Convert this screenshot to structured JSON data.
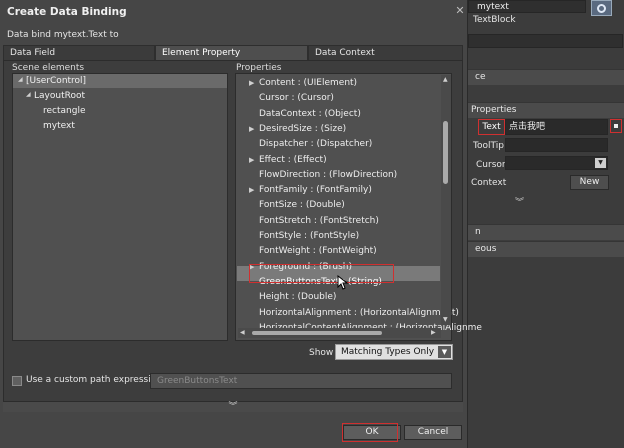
{
  "dialog": {
    "title": "Create Data Binding",
    "close_glyph": "✕",
    "bind_label": "Data bind mytext.Text to",
    "tabs": [
      {
        "label": "Data Field"
      },
      {
        "label": "Element Property"
      },
      {
        "label": "Data Context"
      }
    ],
    "scene_label": "Scene elements",
    "properties_label": "Properties",
    "tree": [
      {
        "label": "[UserControl]",
        "selected": true
      },
      {
        "label": "LayoutRoot"
      },
      {
        "label": "rectangle"
      },
      {
        "label": "mytext"
      }
    ],
    "properties": [
      {
        "label": "Content : (UIElement)",
        "expandable": true
      },
      {
        "label": "Cursor : (Cursor)"
      },
      {
        "label": "DataContext : (Object)"
      },
      {
        "label": "DesiredSize : (Size)",
        "expandable": true
      },
      {
        "label": "Dispatcher : (Dispatcher)"
      },
      {
        "label": "Effect : (Effect)",
        "expandable": true
      },
      {
        "label": "FlowDirection : (FlowDirection)"
      },
      {
        "label": "FontFamily : (FontFamily)",
        "expandable": true
      },
      {
        "label": "FontSize : (Double)"
      },
      {
        "label": "FontStretch : (FontStretch)"
      },
      {
        "label": "FontStyle : (FontStyle)"
      },
      {
        "label": "FontWeight : (FontWeight)"
      },
      {
        "label": "Foreground : (Brush)",
        "expandable": true
      },
      {
        "label": "GreenButtonsText : (String)",
        "selected": true
      },
      {
        "label": "Height : (Double)"
      },
      {
        "label": "HorizontalAlignment : (HorizontalAlignment)"
      },
      {
        "label": "HorizontalContentAlignment : (HorizontalAlignme"
      }
    ],
    "show_label": "Show",
    "show_value": "Matching Types Only",
    "custom_path_label": "Use a custom path expression",
    "custom_path_checked": false,
    "path_placeholder": "GreenButtonsText",
    "ok_label": "OK",
    "cancel_label": "Cancel"
  },
  "background_panel": {
    "element_name": "mytext",
    "element_type": "TextBlock",
    "section_ce": "ce",
    "section_properties": "Properties",
    "text_label": "Text",
    "text_value": "点击我吧",
    "tooltip_label": "ToolTip",
    "cursor_label": "Cursor",
    "context_label": "Context",
    "new_button": "New",
    "row_n": "n",
    "row_eous": "eous"
  },
  "colors": {
    "highlight_red": "#d03030",
    "selected_row": "#7a7a7a",
    "dialog_bg": "#464646"
  }
}
